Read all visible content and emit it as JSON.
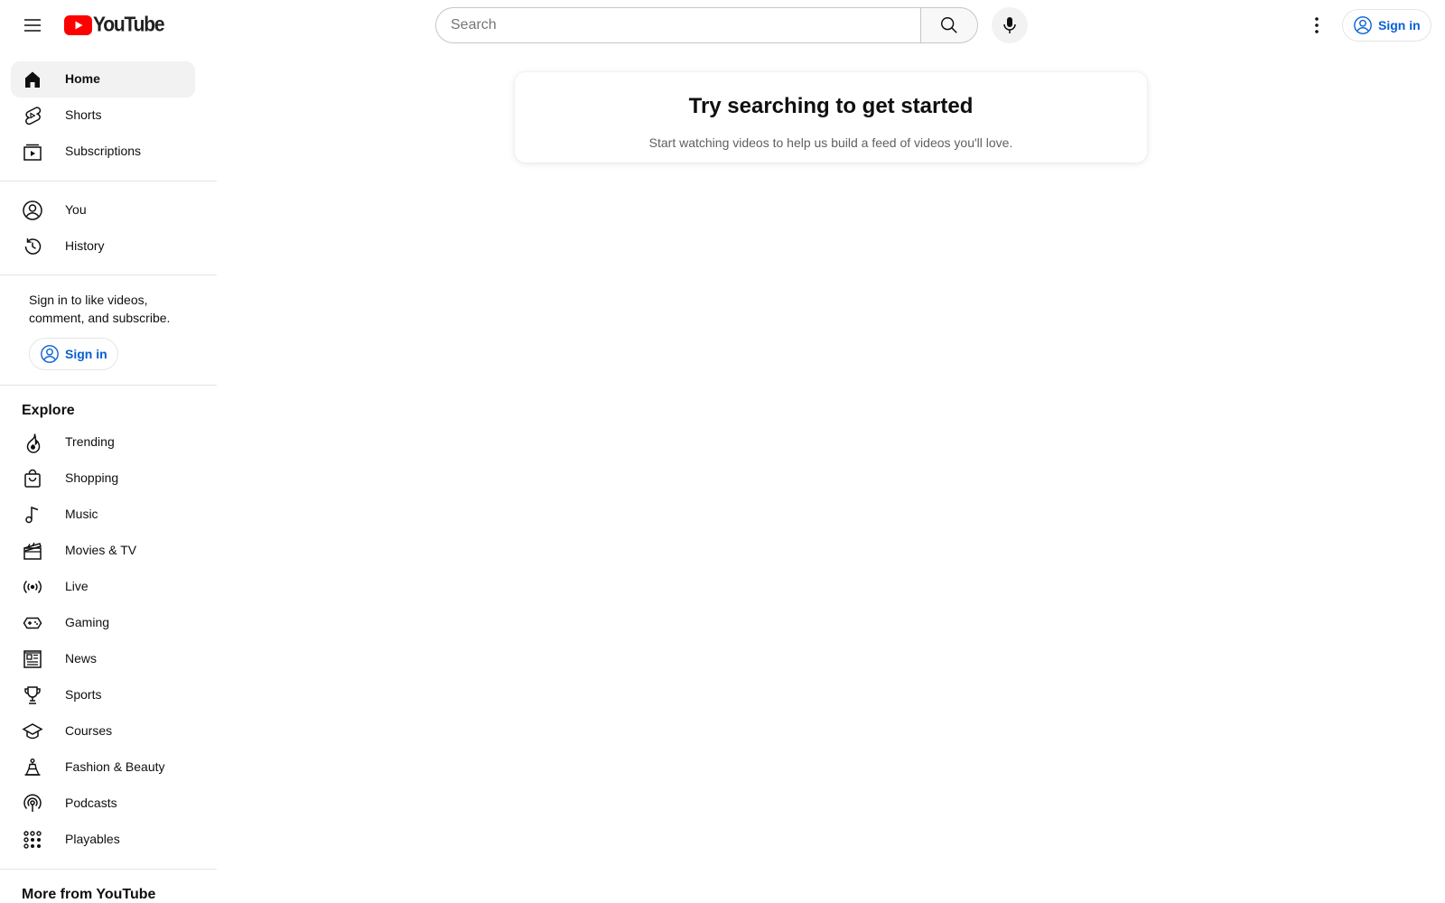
{
  "header": {
    "logo_text": "YouTube",
    "search_placeholder": "Search",
    "signin_label": "Sign in"
  },
  "sidebar": {
    "main_items": [
      {
        "label": "Home",
        "icon": "home-icon",
        "active": true
      },
      {
        "label": "Shorts",
        "icon": "shorts-icon"
      },
      {
        "label": "Subscriptions",
        "icon": "subscriptions-icon"
      }
    ],
    "you_items": [
      {
        "label": "You",
        "icon": "account-icon"
      },
      {
        "label": "History",
        "icon": "history-icon"
      }
    ],
    "signin_promo": "Sign in to like videos, comment, and subscribe.",
    "signin_label": "Sign in",
    "explore_title": "Explore",
    "explore_items": [
      {
        "label": "Trending",
        "icon": "trending-icon"
      },
      {
        "label": "Shopping",
        "icon": "shopping-icon"
      },
      {
        "label": "Music",
        "icon": "music-icon"
      },
      {
        "label": "Movies & TV",
        "icon": "movies-icon"
      },
      {
        "label": "Live",
        "icon": "live-icon"
      },
      {
        "label": "Gaming",
        "icon": "gaming-icon"
      },
      {
        "label": "News",
        "icon": "news-icon"
      },
      {
        "label": "Sports",
        "icon": "sports-icon"
      },
      {
        "label": "Courses",
        "icon": "courses-icon"
      },
      {
        "label": "Fashion & Beauty",
        "icon": "fashion-icon"
      },
      {
        "label": "Podcasts",
        "icon": "podcasts-icon"
      },
      {
        "label": "Playables",
        "icon": "playables-icon"
      }
    ],
    "more_title": "More from YouTube"
  },
  "main": {
    "prompt_title": "Try searching to get started",
    "prompt_subtitle": "Start watching videos to help us build a feed of videos you'll love."
  },
  "colors": {
    "brand_red": "#ff0000",
    "link_blue": "#065fd4",
    "active_bg": "#f2f2f2"
  }
}
